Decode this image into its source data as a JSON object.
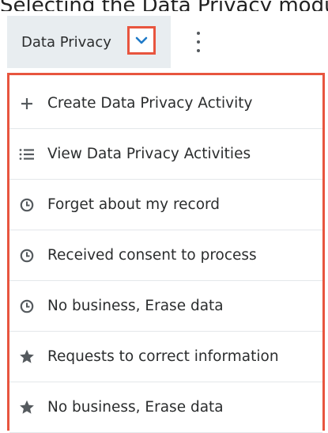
{
  "page": {
    "cropped_caption": "Selecting the Data Privacy module tab"
  },
  "nav": {
    "module_tab_label": "Data Privacy",
    "caret_icon": "chevron-down-icon",
    "more_icon": "kebab-menu-icon"
  },
  "menu": {
    "items": [
      {
        "label": "Create Data Privacy Activity",
        "icon": "plus-icon"
      },
      {
        "label": "View Data Privacy Activities",
        "icon": "list-icon"
      },
      {
        "label": "Forget about my record",
        "icon": "clock-icon"
      },
      {
        "label": "Received consent to process",
        "icon": "clock-icon"
      },
      {
        "label": "No business, Erase data",
        "icon": "clock-icon"
      },
      {
        "label": "Requests to correct information",
        "icon": "star-icon"
      },
      {
        "label": "No business, Erase data",
        "icon": "star-icon"
      }
    ]
  },
  "colors": {
    "highlight_border": "#e8553f",
    "tab_background": "#e8edf0",
    "caret_blue": "#1f7ac8",
    "icon_gray": "#555a5e"
  }
}
